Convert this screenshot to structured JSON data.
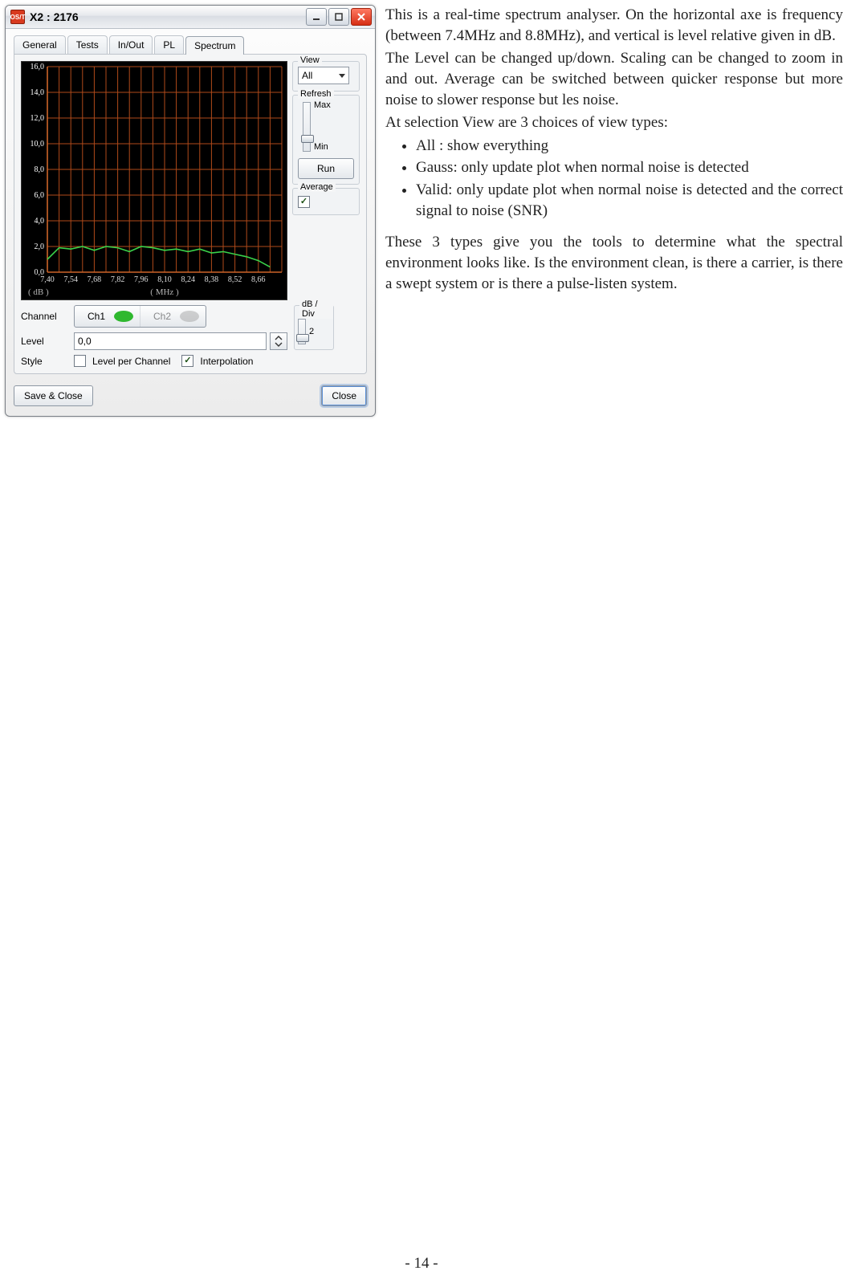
{
  "window": {
    "title": "X2 : 2176",
    "app_icon_text": "OS/T",
    "tabs": [
      "General",
      "Tests",
      "In/Out",
      "PL",
      "Spectrum"
    ],
    "active_tab": "Spectrum",
    "view_group": "View",
    "view_value": "All",
    "refresh_group": "Refresh",
    "refresh_max": "Max",
    "refresh_min": "Min",
    "run_btn": "Run",
    "avg_group": "Average",
    "dbdiv_group": "dB / Div",
    "dbdiv_value": "2",
    "channel_lbl": "Channel",
    "ch1": "Ch1",
    "ch2": "Ch2",
    "level_lbl": "Level",
    "level_value": "0,0",
    "style_lbl": "Style",
    "level_per_ch": "Level per Channel",
    "interp": "Interpolation",
    "save_close": "Save & Close",
    "close": "Close"
  },
  "chart_data": {
    "type": "line",
    "xlabel": "( MHz )",
    "ylabel": "( dB )",
    "x_ticks": [
      "7,40",
      "7,54",
      "7,68",
      "7,82",
      "7,96",
      "8,10",
      "8,24",
      "8,38",
      "8,52",
      "8,66"
    ],
    "y_ticks": [
      "0,0",
      "2,0",
      "4,0",
      "6,0",
      "8,0",
      "10,0",
      "12,0",
      "14,0",
      "16,0"
    ],
    "ylim": [
      0,
      16
    ],
    "series": [
      {
        "name": "Ch1",
        "color": "#3ad24a",
        "x": [
          7.4,
          7.47,
          7.54,
          7.61,
          7.68,
          7.75,
          7.82,
          7.89,
          7.96,
          8.03,
          8.1,
          8.17,
          8.24,
          8.31,
          8.38,
          8.45,
          8.52,
          8.59,
          8.66,
          8.73
        ],
        "y": [
          1.0,
          1.9,
          1.8,
          2.0,
          1.7,
          2.0,
          1.9,
          1.6,
          2.0,
          1.9,
          1.7,
          1.8,
          1.6,
          1.8,
          1.5,
          1.6,
          1.4,
          1.2,
          0.9,
          0.4
        ]
      }
    ]
  },
  "article": {
    "p1": "This is a real-time spectrum analyser. On the horizontal axe is frequency (between 7.4MHz and 8.8MHz), and vertical is level relative given in dB.",
    "p2": "The Level can be changed up/down. Scaling can be changed to zoom in and out. Average can be switched between quicker response but more noise to slower response but les noise.",
    "p3": "At selection View are 3 choices of view types:",
    "li1": "All : show everything",
    "li2": "Gauss: only update plot when normal noise is detected",
    "li3": "Valid: only update plot when normal noise is detected and the correct signal to noise (SNR)",
    "p4": "These 3 types give you the tools to determine what the spectral environment looks like. Is the environment clean, is there a carrier, is there a swept system or is there a pulse-listen system."
  },
  "page_number": "- 14 -"
}
